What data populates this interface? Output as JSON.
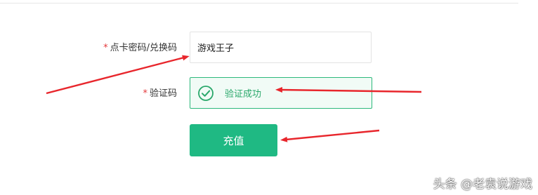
{
  "form": {
    "required_mark": "*",
    "code_label": "点卡密码/兑换码",
    "code_value": "游戏王子",
    "verify_label": "验证码",
    "verify_status": "验证成功",
    "submit_label": "充值"
  },
  "watermark": "头条 @老袁说游戏",
  "icons": {
    "verify": "check-circle-icon"
  },
  "colors": {
    "accent_green": "#1fb983",
    "success_text": "#2aa86b",
    "required": "#e4393c",
    "annotation_arrow": "#e8262c"
  }
}
